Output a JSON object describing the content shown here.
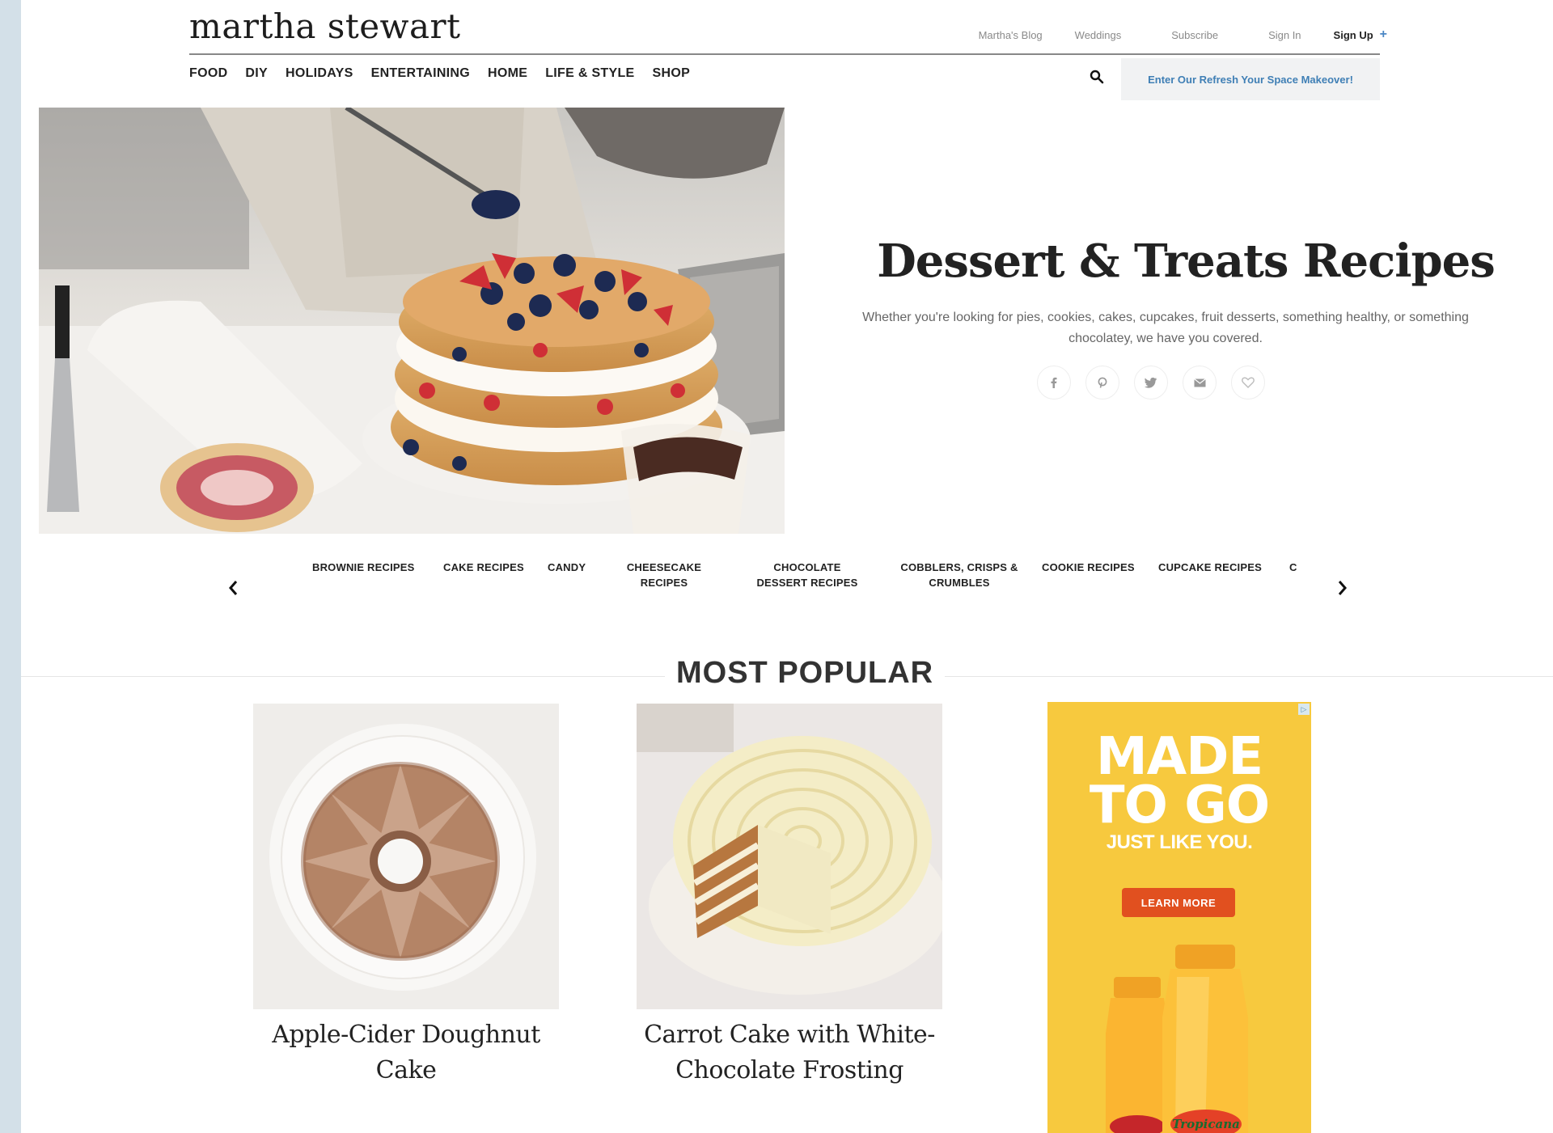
{
  "header": {
    "logo": "martha stewart",
    "utility": {
      "blog": "Martha's Blog",
      "weddings": "Weddings",
      "subscribe": "Subscribe",
      "signin": "Sign In",
      "signup": "Sign Up",
      "signup_icon": "+"
    },
    "nav": [
      "FOOD",
      "DIY",
      "HOLIDAYS",
      "ENTERTAINING",
      "HOME",
      "LIFE & STYLE",
      "SHOP"
    ],
    "promo": "Enter Our Refresh Your Space Makeover!"
  },
  "hero": {
    "title": "Dessert & Treats Recipes",
    "description": "Whether you're looking for pies, cookies, cakes, cupcakes, fruit desserts, something healthy, or something chocolatey, we have you covered.",
    "share": [
      "facebook-icon",
      "pinterest-icon",
      "twitter-icon",
      "email-icon",
      "heart-icon"
    ]
  },
  "categories": [
    "BROWNIE RECIPES",
    "CAKE RECIPES",
    "CANDY",
    "CHEESECAKE RECIPES",
    "CHOCOLATE DESSERT RECIPES",
    "COBBLERS, CRISPS & CRUMBLES",
    "COOKIE RECIPES",
    "CUPCAKE RECIPES",
    "C"
  ],
  "most_popular": {
    "title": "MOST POPULAR",
    "cards": [
      {
        "title": "Apple-Cider Doughnut Cake"
      },
      {
        "title": "Carrot Cake with White-Chocolate Frosting"
      }
    ]
  },
  "ad": {
    "headline_1": "MADE",
    "headline_2": "TO GO",
    "sub": "JUST LIKE YOU.",
    "cta": "LEARN MORE",
    "brand": "Tropicana",
    "colors": {
      "background": "#f7c93e",
      "cta": "#e1501f"
    }
  }
}
